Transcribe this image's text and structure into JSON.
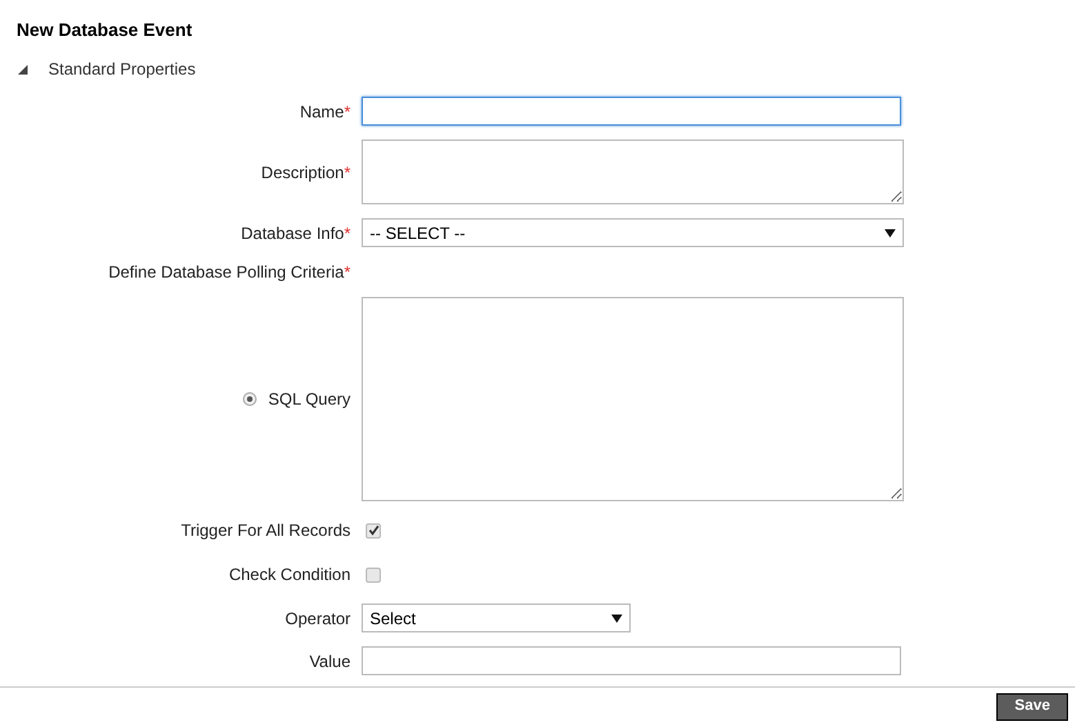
{
  "title": "New Database Event",
  "section": {
    "label": "Standard Properties",
    "expanded": true
  },
  "fields": [
    {
      "kind": "text",
      "label": "Name",
      "required_mark": "*",
      "focused": true
    },
    {
      "kind": "textarea",
      "label": "Description",
      "required_mark": "*"
    },
    {
      "kind": "select",
      "label": "Database Info",
      "required_mark": "*",
      "value": "-- SELECT --"
    },
    {
      "kind": "heading",
      "label": "Define Database Polling Criteria",
      "required_mark": "*"
    },
    {
      "kind": "radio-textarea",
      "label": "SQL Query",
      "selected": true
    },
    {
      "kind": "checkbox",
      "label": "Trigger For All Records",
      "checked": true
    },
    {
      "kind": "checkbox",
      "label": "Check Condition",
      "checked": false
    },
    {
      "kind": "short-select",
      "label": "Operator",
      "value": "Select"
    },
    {
      "kind": "text",
      "label": "Value",
      "focused": false
    }
  ],
  "buttons": [
    "Save"
  ]
}
